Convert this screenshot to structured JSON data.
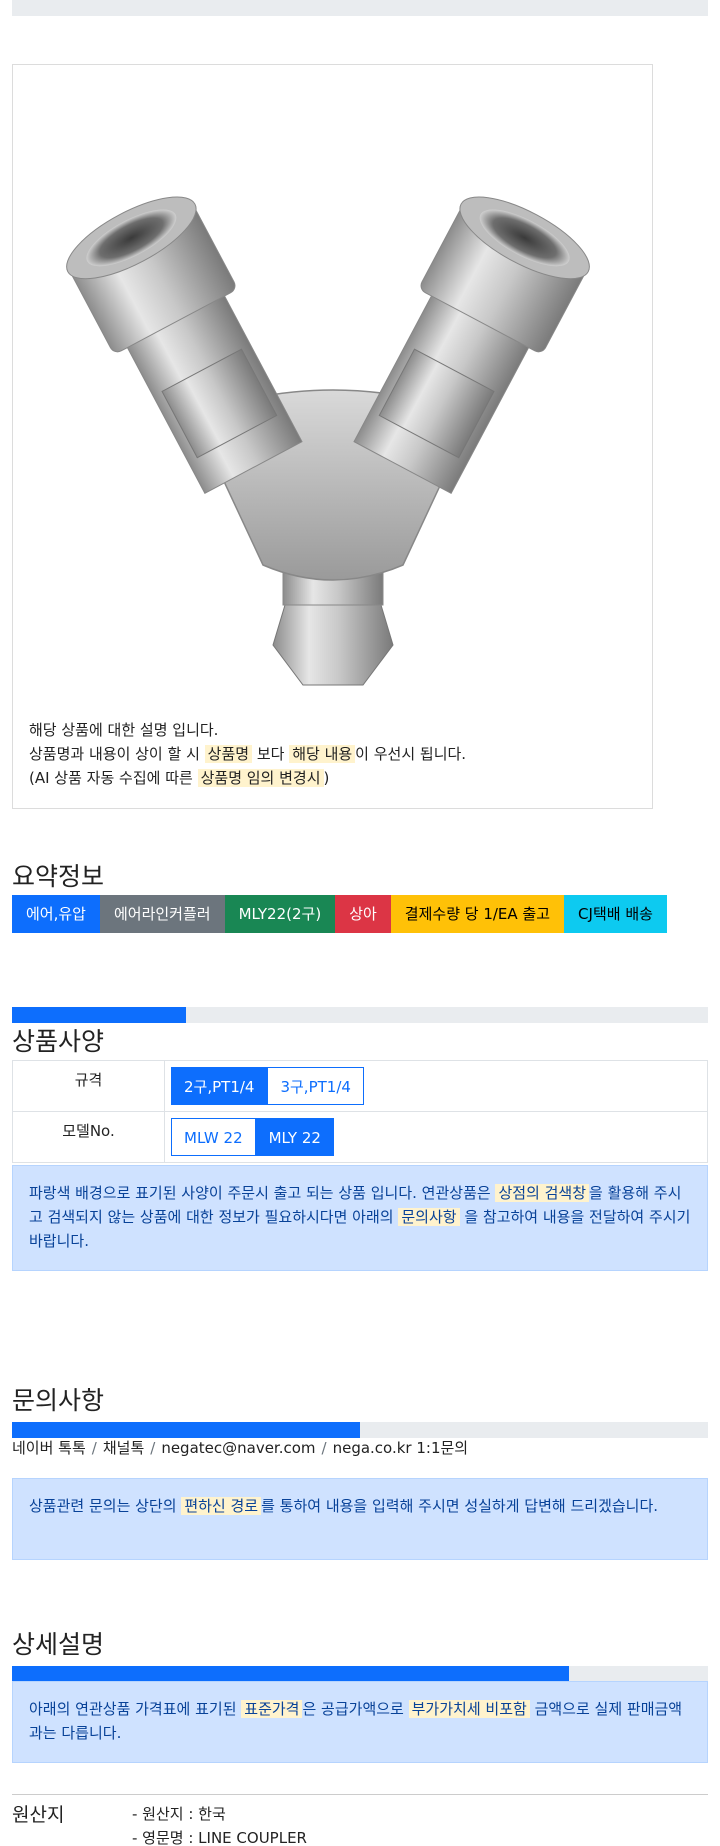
{
  "notice": {
    "line1": "해당 상품에 대한 설명 입니다.",
    "line2_pre": "상품명과 내용이 상이 할 시 ",
    "line2_hl1": "상품명",
    "line2_mid": " 보다 ",
    "line2_hl2": "해당 내용",
    "line2_post": "이 우선시 됩니다.",
    "line3_pre": "(AI 상품 자동 수집에 따른 ",
    "line3_hl": "상품명 임의 변경시",
    "line3_post": ")"
  },
  "summary": {
    "title": "요약정보",
    "badges": [
      {
        "label": "에어,유압",
        "color": "#0d6efd",
        "text_color": "#ffffff"
      },
      {
        "label": "에어라인커플러",
        "color": "#6c757d",
        "text_color": "#ffffff"
      },
      {
        "label": "MLY22(2구)",
        "color": "#198754",
        "text_color": "#ffffff"
      },
      {
        "label": "상아",
        "color": "#dc3545",
        "text_color": "#ffffff"
      },
      {
        "label": "결제수량 당 1/EA 출고",
        "color": "#ffc107",
        "text_color": "#000000"
      },
      {
        "label": "CJ택배 배송",
        "color": "#0dcaf0",
        "text_color": "#000000"
      }
    ]
  },
  "spec": {
    "title": "상품사양",
    "progress_fraction": 0.25,
    "rows": [
      {
        "label": "규격",
        "options": [
          "2구,PT1/4",
          "3구,PT1/4"
        ],
        "selected": 0
      },
      {
        "label": "모델No.",
        "options": [
          "MLW 22",
          "MLY 22"
        ],
        "selected": 1
      }
    ],
    "info_pre": "파랑색 배경으로 표기된 사양이 주문시 출고 되는 상품 입니다. 연관상품은 ",
    "info_hl1": "상점의 검색창",
    "info_mid": "을 활용해 주시고 검색되지 않는 상품에 대한 정보가 필요하시다면 아래의 ",
    "info_hl2": "문의사항",
    "info_post": " 을 참고하여 내용을 전달하여 주시기 바랍니다."
  },
  "inquiry": {
    "title": "문의사항",
    "progress_fraction": 0.5,
    "links": [
      "네이버 톡톡",
      "채널톡",
      "negatec@naver.com",
      "nega.co.kr 1:1문의"
    ],
    "separator": "/",
    "info_pre": "상품관련 문의는 상단의 ",
    "info_hl": "편하신 경로",
    "info_post": "를 통하여 내용을 입력해 주시면 성실하게 답변해 드리겠습니다."
  },
  "detail": {
    "title": "상세설명",
    "progress_fraction": 0.8,
    "info_pre": "아래의 연관상품 가격표에 표기된 ",
    "info_hl1": "표준가격",
    "info_mid": "은 공급가액으로 ",
    "info_hl2": "부가가치세 비포함",
    "info_post": " 금액으로 실제 판매금액과는 다릅니다."
  },
  "origin": {
    "label": "원산지",
    "values": [
      "- 원산지 : 한국",
      "- 영문명 : LINE COUPLER"
    ]
  },
  "colors": {
    "primary": "#0d6efd",
    "info_bg": "#cfe2ff",
    "info_text": "#084298",
    "highlight": "#fff3cd"
  }
}
